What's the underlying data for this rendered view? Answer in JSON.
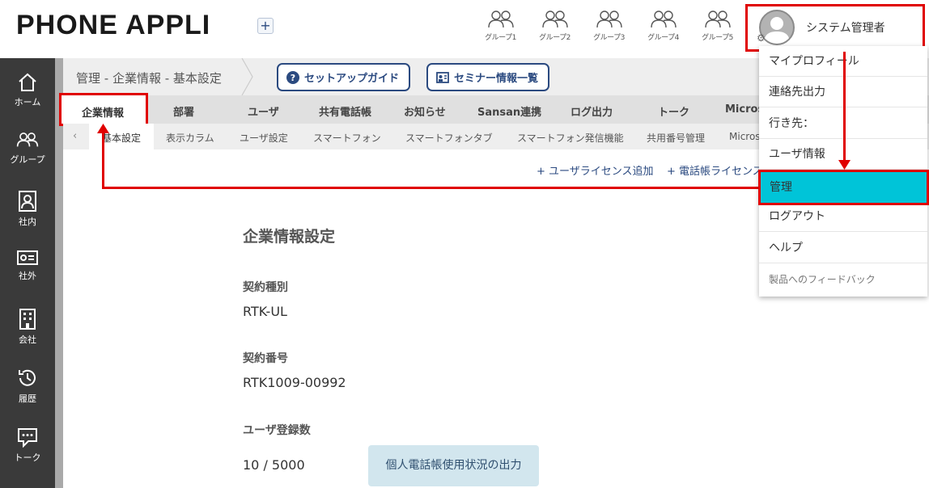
{
  "header": {
    "logo": "PHONE APPLI",
    "add_label": "+",
    "groups": [
      "グループ1",
      "グループ2",
      "グループ3",
      "グループ4",
      "グループ5"
    ],
    "user_name": "システム管理者"
  },
  "leftnav": [
    "ホーム",
    "グループ",
    "社内",
    "社外",
    "会社",
    "履歴",
    "トーク"
  ],
  "breadcrumb": "管理 - 企業情報 - 基本設定",
  "buttons": {
    "setup_guide": "セットアップガイド",
    "seminar": "セミナー情報一覧"
  },
  "tabs_main": {
    "active": "企業情報",
    "items": [
      "部署",
      "ユーザ",
      "共有電話帳",
      "お知らせ",
      "Sansan連携",
      "ログ出力",
      "トーク",
      "Micros"
    ]
  },
  "tabs_sub": {
    "prev": "‹",
    "active": "基本設定",
    "items": [
      "表示カラム",
      "ユーザ設定",
      "スマートフォン",
      "スマートフォンタブ",
      "スマートフォン発信機能",
      "共用番号管理",
      "Micros"
    ]
  },
  "license_links": [
    "+ ユーザライセンス追加",
    "+ 電話帳ライセンス"
  ],
  "content": {
    "section_title": "企業情報設定",
    "contract_type_label": "契約種別",
    "contract_type_value": "RTK-UL",
    "contract_no_label": "契約番号",
    "contract_no_value": "RTK1009-00992",
    "user_count_label": "ユーザ登録数",
    "user_count_value": "10 / 5000",
    "export_button": "個人電話帳使用状況の出力"
  },
  "menu": {
    "items": [
      "マイプロフィール",
      "連絡先出力",
      "行き先：",
      "ユーザ情報",
      "管理",
      "ログアウト",
      "ヘルプ",
      "製品へのフィードバック"
    ],
    "active_index": 4
  },
  "colors": {
    "accent_red": "#e00000",
    "active_menu": "#00c4d8",
    "brand_navy": "#2b4a80"
  }
}
